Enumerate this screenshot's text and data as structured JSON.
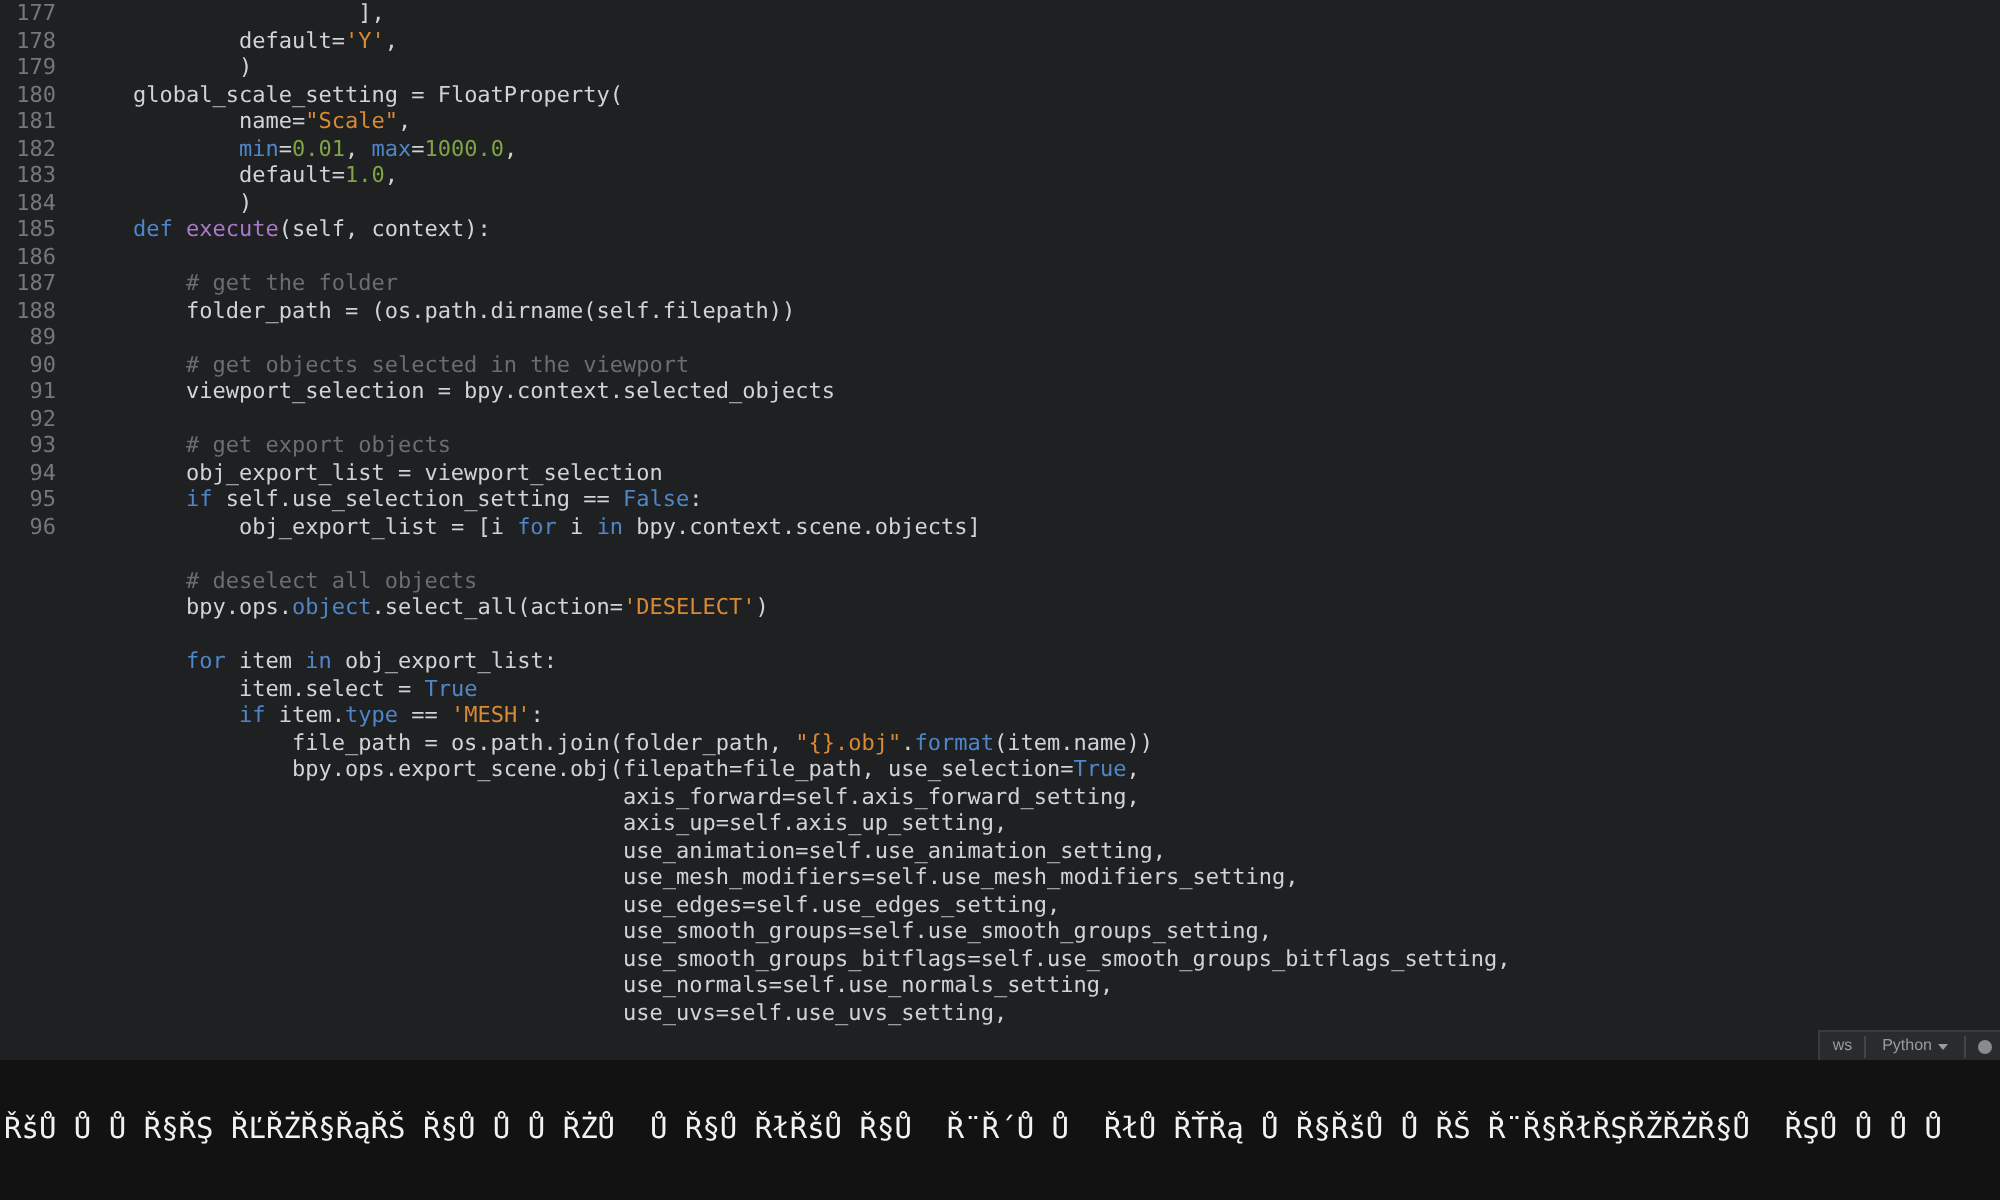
{
  "editor": {
    "blocks": [
      {
        "lines": [
          {
            "number": "177",
            "segments": [
              {
                "kind": "plain",
                "text": "                     ],"
              }
            ]
          },
          {
            "number": "178",
            "segments": [
              {
                "kind": "plain",
                "text": "            default="
              },
              {
                "kind": "string",
                "text": "'Y'"
              },
              {
                "kind": "plain",
                "text": ","
              }
            ]
          },
          {
            "number": "179",
            "segments": [
              {
                "kind": "plain",
                "text": "            )"
              }
            ]
          },
          {
            "number": "180",
            "segments": [
              {
                "kind": "plain",
                "text": "    global_scale_setting = FloatProperty("
              }
            ]
          },
          {
            "number": "181",
            "segments": [
              {
                "kind": "plain",
                "text": "            name="
              },
              {
                "kind": "string",
                "text": "\"Scale\""
              },
              {
                "kind": "plain",
                "text": ","
              }
            ]
          },
          {
            "number": "182",
            "segments": [
              {
                "kind": "keyword",
                "text": "            min"
              },
              {
                "kind": "plain",
                "text": "="
              },
              {
                "kind": "number",
                "text": "0.01"
              },
              {
                "kind": "plain",
                "text": ", "
              },
              {
                "kind": "keyword",
                "text": "max"
              },
              {
                "kind": "plain",
                "text": "="
              },
              {
                "kind": "number",
                "text": "1000.0"
              },
              {
                "kind": "plain",
                "text": ","
              }
            ]
          },
          {
            "number": "183",
            "segments": [
              {
                "kind": "plain",
                "text": "            default="
              },
              {
                "kind": "number",
                "text": "1.0"
              },
              {
                "kind": "plain",
                "text": ","
              }
            ]
          },
          {
            "number": "184",
            "segments": [
              {
                "kind": "plain",
                "text": "            )"
              }
            ]
          },
          {
            "number": "185",
            "segments": [
              {
                "kind": "keyword",
                "text": "    def "
              },
              {
                "kind": "function",
                "text": "execute"
              },
              {
                "kind": "plain",
                "text": "(self, context):"
              }
            ]
          },
          {
            "number": "186"
          },
          {
            "number": "187",
            "segments": [
              {
                "kind": "comment",
                "text": "        # get the folder"
              }
            ]
          },
          {
            "number": "188",
            "segments": [
              {
                "kind": "plain",
                "text": "        folder_path = (os.path.dirname(self.filepath))"
              }
            ]
          },
          {
            "number": "89"
          },
          {
            "number": "90",
            "segments": [
              {
                "kind": "comment",
                "text": "        # get objects selected in the viewport"
              }
            ]
          },
          {
            "number": "91",
            "segments": [
              {
                "kind": "plain",
                "text": "        viewport_selection = bpy.context.selected_objects"
              }
            ]
          },
          {
            "number": "92"
          },
          {
            "number": "93",
            "segments": [
              {
                "kind": "comment",
                "text": "        # get export objects"
              }
            ]
          },
          {
            "number": "94",
            "segments": [
              {
                "kind": "plain",
                "text": "        obj_export_list = viewport_selection"
              }
            ]
          },
          {
            "number": "95",
            "segments": [
              {
                "kind": "keyword",
                "text": "        if"
              },
              {
                "kind": "plain",
                "text": " self.use_selection_setting == "
              },
              {
                "kind": "keyword",
                "text": "False"
              },
              {
                "kind": "plain",
                "text": ":"
              }
            ]
          },
          {
            "number": "96",
            "segments": [
              {
                "kind": "plain",
                "text": "            obj_export_list = [i "
              },
              {
                "kind": "keyword",
                "text": "for"
              },
              {
                "kind": "plain",
                "text": " i "
              },
              {
                "kind": "keyword",
                "text": "in"
              },
              {
                "kind": "plain",
                "text": " bpy.context.scene.objects]"
              }
            ]
          }
        ]
      },
      {
        "lines": [
          {
            "segments": [
              {
                "kind": "comment",
                "text": "        # deselect all objects"
              }
            ]
          },
          {
            "segments": [
              {
                "kind": "plain",
                "text": "        bpy.ops."
              },
              {
                "kind": "keyword",
                "text": "object"
              },
              {
                "kind": "plain",
                "text": ".select_all(action="
              },
              {
                "kind": "string",
                "text": "'DESELECT'"
              },
              {
                "kind": "plain",
                "text": ")"
              }
            ]
          }
        ]
      },
      {
        "lines": [
          {
            "segments": [
              {
                "kind": "keyword",
                "text": "        for"
              },
              {
                "kind": "plain",
                "text": " item "
              },
              {
                "kind": "keyword",
                "text": "in"
              },
              {
                "kind": "plain",
                "text": " obj_export_list:"
              }
            ]
          },
          {
            "segments": [
              {
                "kind": "plain",
                "text": "            item.select = "
              },
              {
                "kind": "keyword",
                "text": "True"
              }
            ]
          },
          {
            "segments": [
              {
                "kind": "keyword",
                "text": "            if"
              },
              {
                "kind": "plain",
                "text": " item."
              },
              {
                "kind": "keyword",
                "text": "type"
              },
              {
                "kind": "plain",
                "text": " == "
              },
              {
                "kind": "string",
                "text": "'MESH'"
              },
              {
                "kind": "plain",
                "text": ":"
              }
            ]
          },
          {
            "segments": [
              {
                "kind": "plain",
                "text": "                file_path = os.path.join(folder_path, "
              },
              {
                "kind": "string",
                "text": "\"{}.obj\""
              },
              {
                "kind": "plain",
                "text": "."
              },
              {
                "kind": "keyword",
                "text": "format"
              },
              {
                "kind": "plain",
                "text": "(item.name))"
              }
            ]
          },
          {
            "segments": [
              {
                "kind": "plain",
                "text": "                bpy.ops.export_scene.obj(filepath=file_path, use_selection="
              },
              {
                "kind": "keyword",
                "text": "True"
              },
              {
                "kind": "plain",
                "text": ","
              }
            ]
          },
          {
            "segments": [
              {
                "kind": "plain",
                "text": "                                         axis_forward=self.axis_forward_setting,"
              }
            ]
          },
          {
            "segments": [
              {
                "kind": "plain",
                "text": "                                         axis_up=self.axis_up_setting,"
              }
            ]
          },
          {
            "segments": [
              {
                "kind": "plain",
                "text": "                                         use_animation=self.use_animation_setting,"
              }
            ]
          },
          {
            "segments": [
              {
                "kind": "plain",
                "text": "                                         use_mesh_modifiers=self.use_mesh_modifiers_setting,"
              }
            ]
          },
          {
            "segments": [
              {
                "kind": "plain",
                "text": "                                         use_edges=self.use_edges_setting,"
              }
            ]
          },
          {
            "segments": [
              {
                "kind": "plain",
                "text": "                                         use_smooth_groups=self.use_smooth_groups_setting,"
              }
            ]
          },
          {
            "segments": [
              {
                "kind": "plain",
                "text": "                                         use_smooth_groups_bitflags=self.use_smooth_groups_bitflags_setting,"
              }
            ]
          },
          {
            "segments": [
              {
                "kind": "plain",
                "text": "                                         use_normals=self.use_normals_setting,"
              }
            ]
          },
          {
            "segments": [
              {
                "kind": "plain",
                "text": "                                         use_uvs=self.use_uvs_setting,"
              }
            ]
          }
        ]
      }
    ]
  },
  "status_bar": {
    "items": [
      {
        "kind": "label",
        "text": "ws"
      },
      {
        "kind": "dropdown",
        "text": "Python"
      }
    ]
  },
  "caption": "ŘšŮ Ů Ů Ř§ŘŞ ŘĽŘŻŘ§ŘąŘŠ Ř§Ů Ů Ů ŘŻŮ  Ů Ř§Ů ŘłŘšŮ Ř§Ů  Ř¨Ř´Ů Ů  ŘłŮ ŘŤŘą Ů Ř§ŘšŮ Ů ŘŠ Ř¨Ř§ŘłŘŞŘŽŘŻŘ§Ů  ŘŞŮ Ů Ů Ů"
}
